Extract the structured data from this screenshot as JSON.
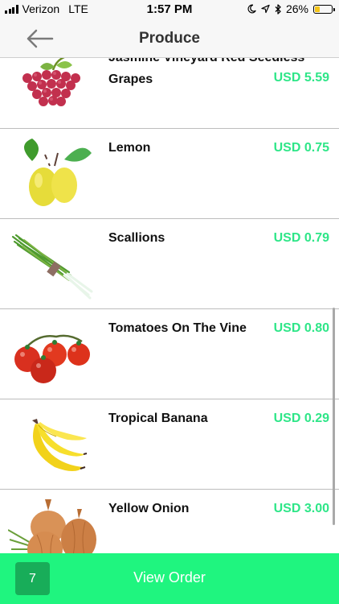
{
  "status_bar": {
    "carrier": "Verizon",
    "network": "LTE",
    "time": "1:57 PM",
    "battery_percent": "26%",
    "battery_level": 0.26,
    "icons": [
      "signal-icon",
      "moon-icon",
      "location-arrow-icon",
      "bluetooth-icon",
      "battery-icon"
    ]
  },
  "nav": {
    "title": "Produce",
    "back_icon": "arrow-left-icon"
  },
  "products": [
    {
      "name_line1": "Jasmine Vineyard Red Seedless",
      "name_line2": "Grapes",
      "price": "USD 5.59",
      "image": "grapes"
    },
    {
      "name": "Lemon",
      "price": "USD 0.75",
      "image": "lemon"
    },
    {
      "name": "Scallions",
      "price": "USD 0.79",
      "image": "scallions"
    },
    {
      "name": "Tomatoes On The Vine",
      "price": "USD 0.80",
      "image": "tomatoes"
    },
    {
      "name": "Tropical Banana",
      "price": "USD 0.29",
      "image": "banana"
    },
    {
      "name": "Yellow Onion",
      "price": "USD 3.00",
      "image": "onion"
    }
  ],
  "order_bar": {
    "count": "7",
    "label": "View Order"
  },
  "colors": {
    "accent_green": "#1ff57f",
    "price_green": "#2ee688",
    "count_badge": "#18ad59"
  }
}
